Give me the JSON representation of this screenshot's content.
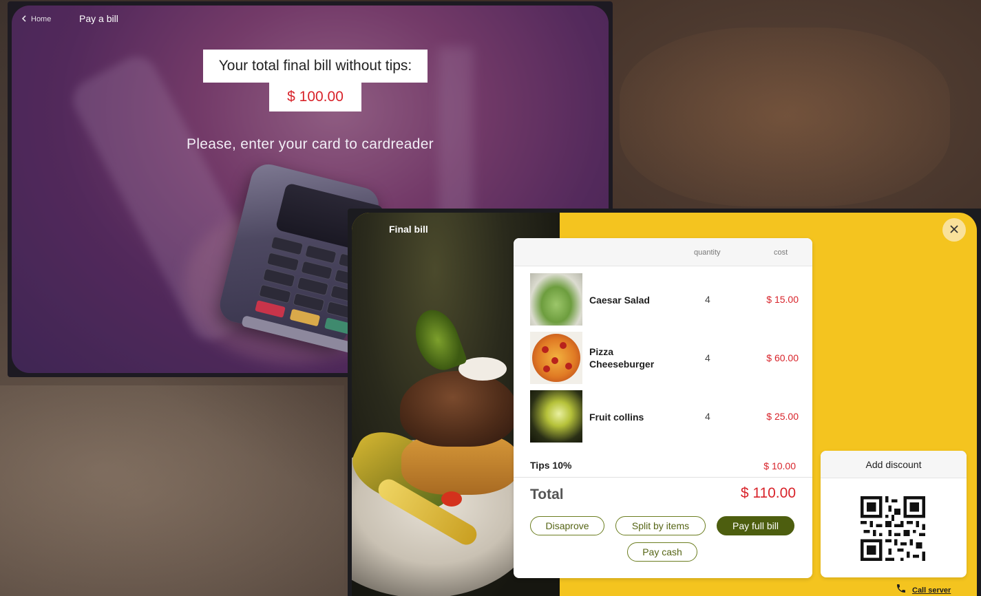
{
  "screen1": {
    "back_label": "Home",
    "title": "Pay a bill",
    "bill_label": "Your total final bill without tips:",
    "bill_amount": "$ 100.00",
    "instruction": "Please, enter your card to cardreader"
  },
  "screen2": {
    "title": "Final bill",
    "columns": {
      "quantity": "quantity",
      "cost": "cost"
    },
    "items": [
      {
        "name": "Caesar Salad",
        "quantity": "4",
        "cost": "$ 15.00"
      },
      {
        "name": "Pizza Cheeseburger",
        "quantity": "4",
        "cost": "$ 60.00"
      },
      {
        "name": "Fruit collins",
        "quantity": "4",
        "cost": "$ 25.00"
      }
    ],
    "tips": {
      "label": "Tips 10%",
      "cost": "$ 10.00"
    },
    "total": {
      "label": "Total",
      "cost": "$ 110.00"
    },
    "buttons": {
      "disapprove": "Disaprove",
      "split": "Split by items",
      "pay_full": "Pay full bill",
      "pay_cash": "Pay cash"
    },
    "discount": {
      "title": "Add discount"
    },
    "call_server": "Call server"
  },
  "icons": {
    "back": "chevron-left-icon",
    "close": "close-icon",
    "phone": "phone-icon",
    "qr": "qr-code-icon"
  },
  "colors": {
    "accent_red": "#d8232a",
    "olive": "#4d5e0f",
    "yellow": "#f4c41f"
  }
}
